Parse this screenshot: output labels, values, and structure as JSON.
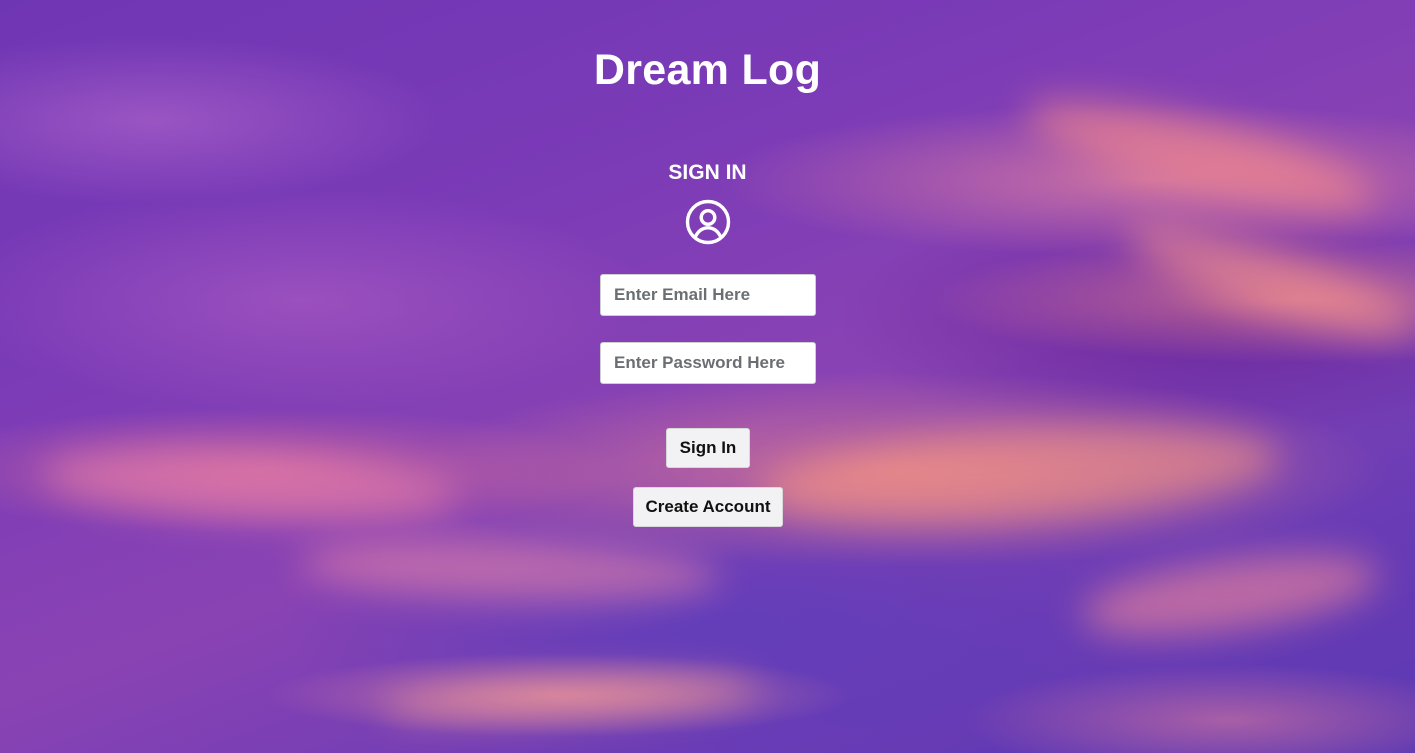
{
  "app": {
    "title": "Dream Log"
  },
  "signin": {
    "heading": "SIGN IN",
    "icon": "user-circle-icon",
    "email": {
      "placeholder": "Enter Email Here",
      "value": ""
    },
    "password": {
      "placeholder": "Enter Password Here",
      "value": ""
    },
    "signin_label": "Sign In",
    "create_label": "Create Account"
  },
  "colors": {
    "text": "#ffffff",
    "button_bg": "#f2f2f4",
    "button_text": "#111111",
    "background_primary": "#7b3bb7",
    "background_accent": "#ff9a8c"
  }
}
